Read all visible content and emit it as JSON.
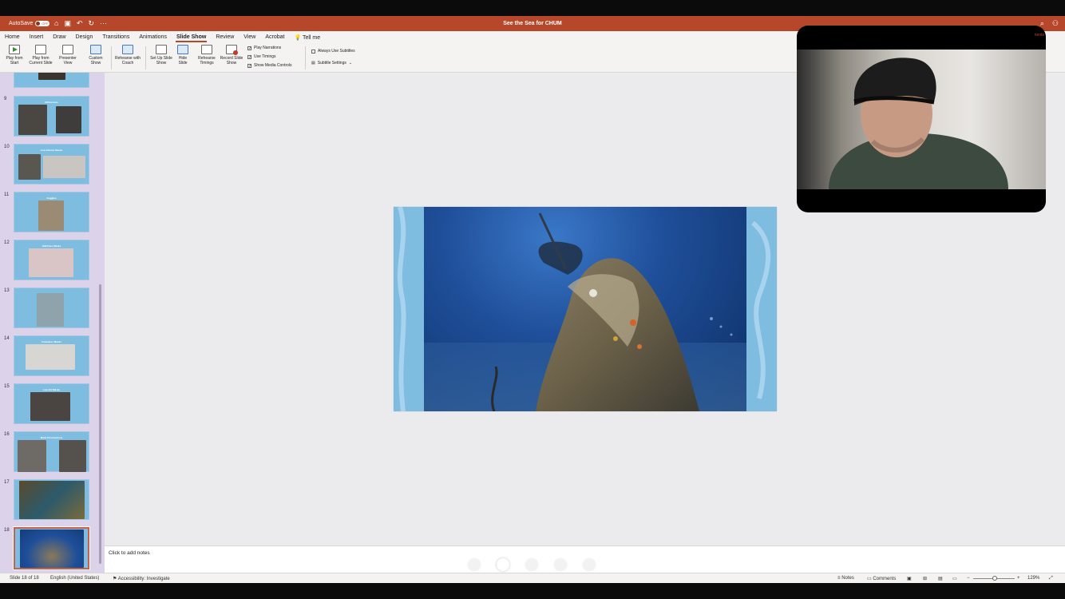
{
  "titlebar": {
    "autosave_label": "AutoSave",
    "autosave_state": "OFF",
    "doc_title": "See the Sea for CHUM",
    "icons": [
      "home-icon",
      "save-icon",
      "undo-icon",
      "redo-icon",
      "more-icon"
    ]
  },
  "ribbon": {
    "tabs": [
      {
        "label": "Home"
      },
      {
        "label": "Insert"
      },
      {
        "label": "Draw"
      },
      {
        "label": "Design"
      },
      {
        "label": "Transitions"
      },
      {
        "label": "Animations"
      },
      {
        "label": "Slide Show",
        "active": true
      },
      {
        "label": "Review"
      },
      {
        "label": "View"
      },
      {
        "label": "Acrobat"
      },
      {
        "label": "Tell me"
      }
    ],
    "buttons": {
      "play_from_start": "Play from Start",
      "play_current": "Play from Current Slide",
      "presenter_view": "Presenter View",
      "custom_show": "Custom Show",
      "rehearse_coach": "Rehearse with Coach",
      "setup_show": "Set Up Slide Show",
      "hide_slide": "Hide Slide",
      "rehearse_timings": "Rehearse Timings",
      "record_show": "Record Slide Show"
    },
    "checks": {
      "play_narrations": "Play Narrations",
      "use_timings": "Use Timings",
      "show_media_controls": "Show Media Controls",
      "always_subtitles": "Always Use Subtitles",
      "subtitle_settings": "Subtitle Settings"
    }
  },
  "sidebar": {
    "slides": [
      {
        "num": "9",
        "title": "Differences"
      },
      {
        "num": "10",
        "title": "Low-Volume Masks"
      },
      {
        "num": "11",
        "title": "Goggles"
      },
      {
        "num": "12",
        "title": "Half-Face Masks"
      },
      {
        "num": "13",
        "title": ""
      },
      {
        "num": "14",
        "title": "Frameless Masks"
      },
      {
        "num": "15",
        "title": "Low-Vol Masks"
      },
      {
        "num": "16",
        "title": "Mask Prescriptions"
      },
      {
        "num": "17",
        "title": ""
      },
      {
        "num": "18",
        "title": "",
        "active": true
      }
    ]
  },
  "notes": {
    "placeholder": "Click to add notes"
  },
  "status": {
    "slide_counter": "Slide 18 of 18",
    "language": "English (United States)",
    "accessibility": "Accessibility: Investigate",
    "notes_btn": "Notes",
    "comments_btn": "Comments",
    "zoom": "129%"
  },
  "video": {
    "edge_label": "nents"
  }
}
